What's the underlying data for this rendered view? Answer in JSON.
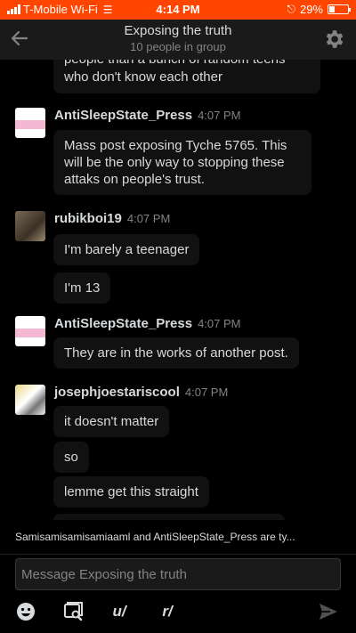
{
  "status_bar": {
    "carrier": "T-Mobile Wi-Fi",
    "time": "4:14 PM",
    "battery_text": "29%",
    "battery_level": 0.29,
    "bar_color": "#ff4500"
  },
  "header": {
    "title": "Exposing the truth",
    "subtitle": "10 people in group",
    "back_icon": "arrow-left-icon",
    "settings_icon": "gear-icon"
  },
  "partial_message": {
    "line1": "people than a bunch of random teens",
    "line2": "who don't know each other"
  },
  "groups": [
    {
      "username": "AntiSleepState_Press",
      "time": "4:07 PM",
      "avatar": "press-avatar",
      "messages": [
        "Mass post exposing Tyche 5765. This will be the only way to stopping these attaks on people's trust."
      ]
    },
    {
      "username": "rubikboi19",
      "time": "4:07 PM",
      "avatar": "rubik-avatar",
      "messages": [
        "I'm barely a teenager",
        "I'm 13"
      ]
    },
    {
      "username": "AntiSleepState_Press",
      "time": "4:07 PM",
      "avatar": "press-avatar",
      "messages": [
        "They are in the works of another post."
      ]
    },
    {
      "username": "josephjoestariscool",
      "time": "4:07 PM",
      "avatar": "joseph-avatar",
      "messages": [
        "it doesn't matter",
        "so",
        "lemme get this straight"
      ]
    }
  ],
  "typing_indicator": "Samisamisamisamiaaml and AntiSleepState_Press are ty...",
  "composer": {
    "placeholder": "Message Exposing the truth",
    "tools": {
      "emoji": "emoji-icon",
      "image": "image-search-icon",
      "user_label": "u/",
      "sub_label": "r/",
      "send": "send-icon"
    }
  },
  "colors": {
    "accent": "#ff4500",
    "background": "#000000",
    "bubble": "#111112",
    "text": "#d7dadc",
    "muted": "#818384"
  }
}
